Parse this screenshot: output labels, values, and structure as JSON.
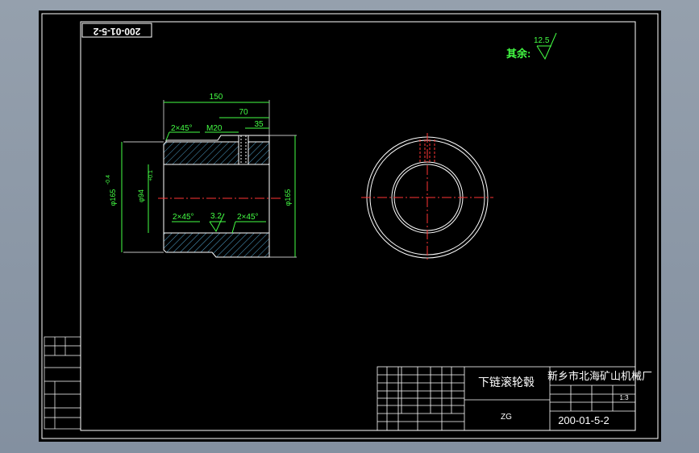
{
  "drawing": {
    "title_stamp": "200-01-5-2",
    "roughness_prefix": "其余:",
    "roughness_value": "12.5"
  },
  "dimensions": {
    "len_total": "150",
    "len_mid": "70",
    "len_slot": "35",
    "chamfer_top": "2×45°",
    "thread": "M20",
    "od_left": "φ165",
    "od_left_tol": "-0.4",
    "bore": "φ94",
    "bore_tol": "+0.1",
    "chamfer_bottom_left": "2×45°",
    "roughness_inner": "3.2",
    "chamfer_bottom_right": "2×45°",
    "od_right": "φ165"
  },
  "title_block": {
    "part_name": "下链滚轮毂",
    "material": "ZG",
    "company": "新乡市北海矿山机械厂",
    "scale": "1:3",
    "drawing_number": "200-01-5-2"
  }
}
